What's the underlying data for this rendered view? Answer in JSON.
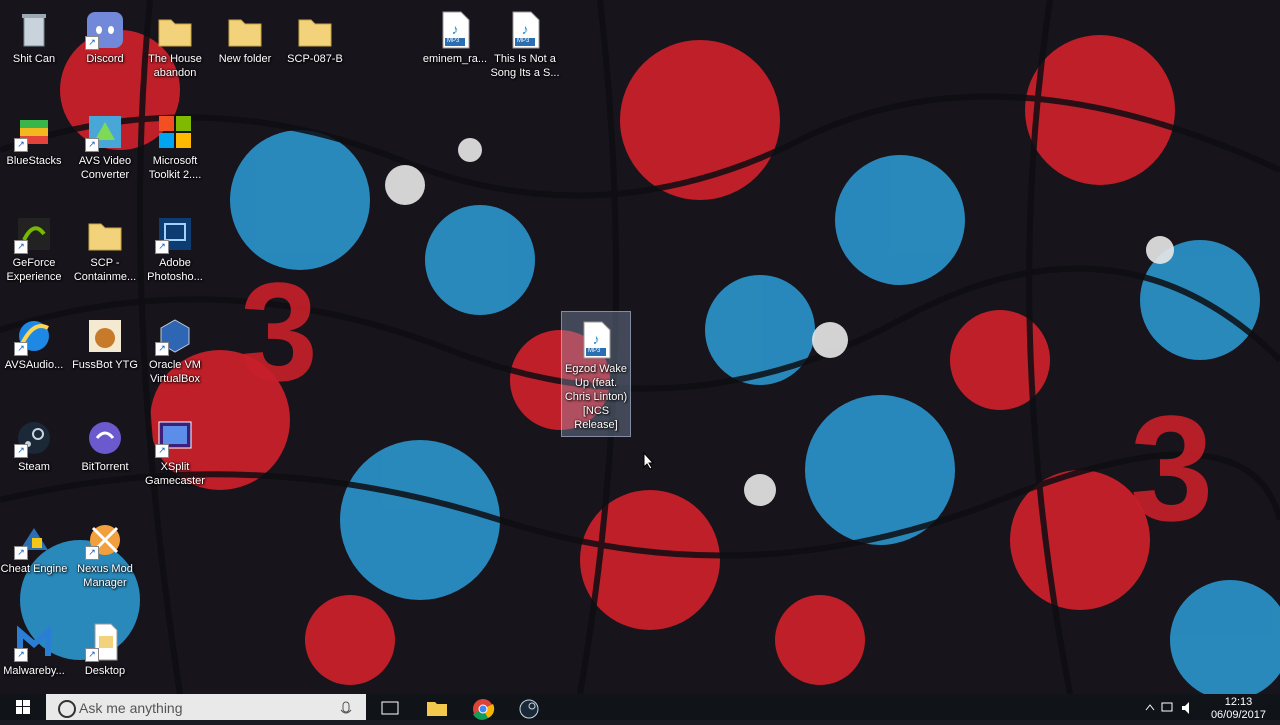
{
  "desktop_icons": [
    {
      "label": "Shit Can",
      "icon": "recycle-bin-icon"
    },
    {
      "label": "Discord",
      "icon": "discord-icon"
    },
    {
      "label": "The House abandon",
      "icon": "folder-icon"
    },
    {
      "label": "New folder",
      "icon": "folder-icon"
    },
    {
      "label": "SCP-087-B",
      "icon": "folder-icon"
    },
    {
      "label": "eminem_ra...",
      "icon": "mp3-file-icon"
    },
    {
      "label": "This Is Not a Song Its a S...",
      "icon": "mp3-file-icon"
    },
    {
      "label": "BlueStacks",
      "icon": "bluestacks-icon"
    },
    {
      "label": "AVS Video Converter",
      "icon": "avs-video-converter-icon"
    },
    {
      "label": "Microsoft Toolkit 2....",
      "icon": "microsoft-toolkit-icon"
    },
    {
      "label": "GeForce Experience",
      "icon": "geforce-icon"
    },
    {
      "label": "SCP - Containme...",
      "icon": "folder-icon"
    },
    {
      "label": "Adobe Photosho...",
      "icon": "photoshop-icon"
    },
    {
      "label": "AVSAudio...",
      "icon": "avs-audio-icon"
    },
    {
      "label": "FussBot YTG",
      "icon": "fussbot-icon"
    },
    {
      "label": "Oracle VM VirtualBox",
      "icon": "virtualbox-icon"
    },
    {
      "label": "Steam",
      "icon": "steam-icon"
    },
    {
      "label": "BitTorrent",
      "icon": "bittorrent-icon"
    },
    {
      "label": "XSplit Gamecaster",
      "icon": "xsplit-icon"
    },
    {
      "label": "Cheat Engine",
      "icon": "cheat-engine-icon"
    },
    {
      "label": "Nexus Mod Manager",
      "icon": "nexus-mod-manager-icon"
    },
    {
      "label": "Malwareby...",
      "icon": "malwarebytes-icon"
    },
    {
      "label": "Desktop",
      "icon": "desktop-file-icon"
    },
    {
      "label": "Egzod Wake Up (feat. Chris Linton) [NCS Release]",
      "icon": "mp3-file-icon"
    }
  ],
  "mp3_badge": "MP3",
  "taskbar": {
    "search_placeholder": "Ask me anything",
    "clock_time": "12:13",
    "clock_date": "06/09/2017"
  },
  "colors": {
    "wallpaper_red": "#c8202a",
    "wallpaper_blue": "#2a8fc4",
    "taskbar_bg": "#101418"
  }
}
